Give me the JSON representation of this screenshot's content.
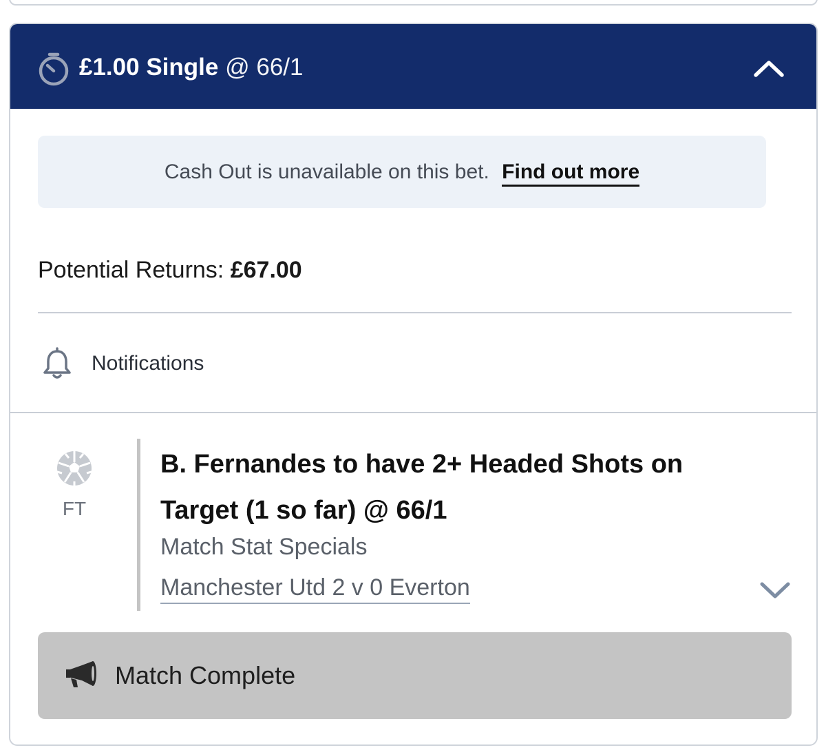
{
  "bet": {
    "stake": "£1.00",
    "bet_type": "Single",
    "odds": "@ 66/1",
    "header_icon": "stopwatch-icon",
    "collapse_icon": "chevron-up-icon",
    "header_color": "#132c6b"
  },
  "cashout": {
    "message": "Cash Out is unavailable on this bet.",
    "link_label": "Find out more"
  },
  "returns": {
    "label": "Potential Returns:",
    "amount": "£67.00"
  },
  "notifications": {
    "label": "Notifications",
    "icon": "bell-icon"
  },
  "selection": {
    "sport_icon": "football-icon",
    "status": "FT",
    "title": "B. Fernandes to have 2+ Headed Shots on Target (1 so far) @ 66/1",
    "market": "Match Stat Specials",
    "event": "Manchester Utd 2 v 0 Everton",
    "expand_icon": "chevron-down-icon"
  },
  "match_status": {
    "label": "Match Complete",
    "icon": "megaphone-icon"
  }
}
